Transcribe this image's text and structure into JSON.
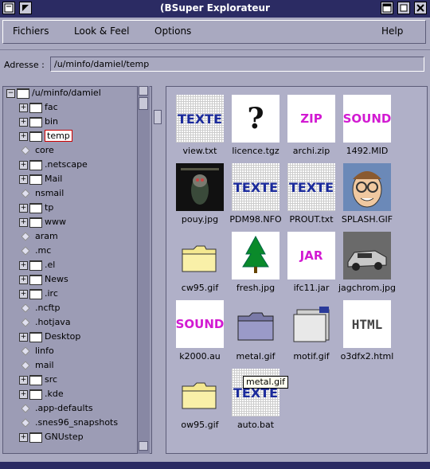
{
  "window": {
    "title": "(BSuper Explorateur"
  },
  "menu": {
    "fichiers": "Fichiers",
    "look": "Look & Feel",
    "options": "Options",
    "help": "Help"
  },
  "address": {
    "label": "Adresse :",
    "value": "/u/minfo/damiel/temp"
  },
  "tree": {
    "root": "/u/minfo/damiel",
    "items": [
      {
        "label": "fac",
        "kind": "folder"
      },
      {
        "label": "bin",
        "kind": "folder"
      },
      {
        "label": "temp",
        "kind": "folder",
        "selected": true
      },
      {
        "label": "core",
        "kind": "file"
      },
      {
        "label": ".netscape",
        "kind": "folder"
      },
      {
        "label": "Mail",
        "kind": "folder"
      },
      {
        "label": "nsmail",
        "kind": "file"
      },
      {
        "label": "tp",
        "kind": "folder"
      },
      {
        "label": "www",
        "kind": "folder"
      },
      {
        "label": "aram",
        "kind": "file"
      },
      {
        "label": ".mc",
        "kind": "file"
      },
      {
        "label": ".el",
        "kind": "folder"
      },
      {
        "label": "News",
        "kind": "folder"
      },
      {
        "label": ".irc",
        "kind": "folder"
      },
      {
        "label": ".ncftp",
        "kind": "file"
      },
      {
        "label": ".hotjava",
        "kind": "file"
      },
      {
        "label": "Desktop",
        "kind": "folder"
      },
      {
        "label": "linfo",
        "kind": "file"
      },
      {
        "label": "mail",
        "kind": "file"
      },
      {
        "label": "src",
        "kind": "folder"
      },
      {
        "label": ".kde",
        "kind": "folder"
      },
      {
        "label": ".app-defaults",
        "kind": "file"
      },
      {
        "label": ".snes96_snapshots",
        "kind": "file"
      },
      {
        "label": "GNUstep",
        "kind": "folder"
      }
    ]
  },
  "files": [
    {
      "name": "view.txt",
      "thumb": "TEXTE",
      "style": "texte grid"
    },
    {
      "name": "licence.tgz",
      "thumb": "?",
      "style": "q white"
    },
    {
      "name": "archi.zip",
      "thumb": "ZIP",
      "style": "pink white"
    },
    {
      "name": "1492.MID",
      "thumb": "SOUND",
      "style": "pink white"
    },
    {
      "name": "pouy.jpg",
      "thumb": "",
      "style": "photo-dark"
    },
    {
      "name": "PDM98.NFO",
      "thumb": "TEXTE",
      "style": "texte grid"
    },
    {
      "name": "PROUT.txt",
      "thumb": "TEXTE",
      "style": "texte grid"
    },
    {
      "name": "SPLASH.GIF",
      "thumb": "",
      "style": "photo-face"
    },
    {
      "name": "cw95.gif",
      "thumb": "",
      "style": "folder-yellow"
    },
    {
      "name": "fresh.jpg",
      "thumb": "",
      "style": "tree-icon"
    },
    {
      "name": "ifc11.jar",
      "thumb": "JAR",
      "style": "pink white"
    },
    {
      "name": "jagchrom.jpg",
      "thumb": "",
      "style": "photo-car"
    },
    {
      "name": "k2000.au",
      "thumb": "SOUND",
      "style": "pink white"
    },
    {
      "name": "metal.gif",
      "thumb": "",
      "style": "folder-metal"
    },
    {
      "name": "motif.gif",
      "thumb": "",
      "style": "folder-motif"
    },
    {
      "name": "o3dfx2.html",
      "thumb": "HTML",
      "style": "html white"
    },
    {
      "name": "ow95.gif",
      "thumb": "",
      "style": "folder-yellow"
    },
    {
      "name": "auto.bat",
      "thumb": "TEXTE",
      "style": "texte grid"
    }
  ],
  "tooltip": "metal.gif"
}
